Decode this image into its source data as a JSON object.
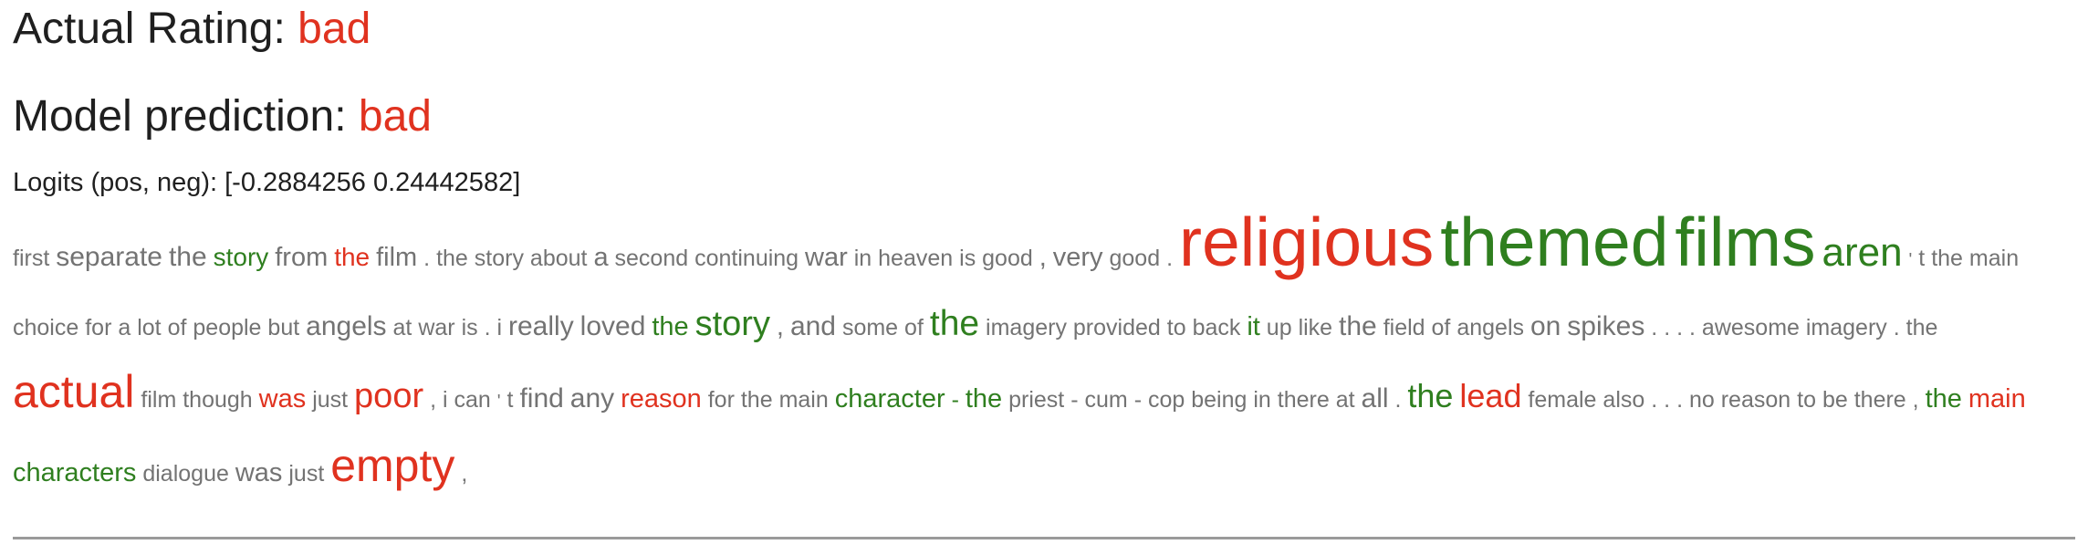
{
  "header": {
    "actual_label": "Actual Rating: ",
    "actual_value": "bad",
    "prediction_label": "Model prediction: ",
    "prediction_value": "bad",
    "logits_text": "Logits (pos, neg): [-0.2884256 0.24442582]"
  },
  "colors": {
    "negative": "#e0321f",
    "positive": "#2f7f1f",
    "neutral": "#737373"
  },
  "tokens": [
    {
      "t": "first",
      "c": "neu",
      "s": 1.0
    },
    {
      "t": "separate",
      "c": "neu",
      "s": 1.2
    },
    {
      "t": "the",
      "c": "neu",
      "s": 1.2
    },
    {
      "t": "story",
      "c": "pos",
      "s": 1.1
    },
    {
      "t": "from",
      "c": "neu",
      "s": 1.15
    },
    {
      "t": "the",
      "c": "neg",
      "s": 1.1
    },
    {
      "t": "film",
      "c": "neu",
      "s": 1.15
    },
    {
      "t": ".",
      "c": "neu",
      "s": 1.0
    },
    {
      "t": "the",
      "c": "neu",
      "s": 1.0
    },
    {
      "t": "story",
      "c": "neu",
      "s": 1.0
    },
    {
      "t": "about",
      "c": "neu",
      "s": 1.0
    },
    {
      "t": "a",
      "c": "neu",
      "s": 1.15
    },
    {
      "t": "second",
      "c": "neu",
      "s": 1.0
    },
    {
      "t": "continuing",
      "c": "neu",
      "s": 1.0
    },
    {
      "t": "war",
      "c": "neu",
      "s": 1.15
    },
    {
      "t": "in",
      "c": "neu",
      "s": 1.0
    },
    {
      "t": "heaven",
      "c": "neu",
      "s": 1.0
    },
    {
      "t": "is",
      "c": "neu",
      "s": 1.0
    },
    {
      "t": "good",
      "c": "neu",
      "s": 1.0
    },
    {
      "t": ",",
      "c": "neu",
      "s": 1.15
    },
    {
      "t": "very",
      "c": "neu",
      "s": 1.15
    },
    {
      "t": "good",
      "c": "neu",
      "s": 1.0
    },
    {
      "t": ".",
      "c": "neu",
      "s": 1.0
    },
    {
      "t": "religious",
      "c": "neg",
      "s": 3.0
    },
    {
      "t": "themed",
      "c": "pos",
      "s": 3.0
    },
    {
      "t": "films",
      "c": "pos",
      "s": 3.0
    },
    {
      "t": "aren",
      "c": "pos",
      "s": 1.75
    },
    {
      "t": "'",
      "c": "neu",
      "s": 0.8
    },
    {
      "t": "t",
      "c": "neu",
      "s": 1.0
    },
    {
      "t": "the",
      "c": "neu",
      "s": 1.0
    },
    {
      "t": "main",
      "c": "neu",
      "s": 1.0
    },
    {
      "t": "choice",
      "c": "neu",
      "s": 1.0
    },
    {
      "t": "for",
      "c": "neu",
      "s": 1.0
    },
    {
      "t": "a",
      "c": "neu",
      "s": 1.0
    },
    {
      "t": "lot",
      "c": "neu",
      "s": 1.0
    },
    {
      "t": "of",
      "c": "neu",
      "s": 1.0
    },
    {
      "t": "people",
      "c": "neu",
      "s": 1.0
    },
    {
      "t": "but",
      "c": "neu",
      "s": 1.0
    },
    {
      "t": "angels",
      "c": "neu",
      "s": 1.2
    },
    {
      "t": "at",
      "c": "neu",
      "s": 1.0
    },
    {
      "t": "war",
      "c": "neu",
      "s": 1.0
    },
    {
      "t": "is",
      "c": "neu",
      "s": 1.0
    },
    {
      "t": ".",
      "c": "neu",
      "s": 1.0
    },
    {
      "t": "i",
      "c": "neu",
      "s": 1.0
    },
    {
      "t": "really",
      "c": "neu",
      "s": 1.2
    },
    {
      "t": "loved",
      "c": "neu",
      "s": 1.2
    },
    {
      "t": "the",
      "c": "pos",
      "s": 1.15
    },
    {
      "t": "story",
      "c": "pos",
      "s": 1.5
    },
    {
      "t": ",",
      "c": "neu",
      "s": 1.15
    },
    {
      "t": "and",
      "c": "neu",
      "s": 1.2
    },
    {
      "t": "some",
      "c": "neu",
      "s": 1.0
    },
    {
      "t": "of",
      "c": "neu",
      "s": 1.0
    },
    {
      "t": "the",
      "c": "pos",
      "s": 1.55
    },
    {
      "t": "imagery",
      "c": "neu",
      "s": 1.0
    },
    {
      "t": "provided",
      "c": "neu",
      "s": 1.0
    },
    {
      "t": "to",
      "c": "neu",
      "s": 1.0
    },
    {
      "t": "back",
      "c": "neu",
      "s": 1.0
    },
    {
      "t": "it",
      "c": "pos",
      "s": 1.15
    },
    {
      "t": "up",
      "c": "neu",
      "s": 1.0
    },
    {
      "t": "like",
      "c": "neu",
      "s": 1.0
    },
    {
      "t": "the",
      "c": "neu",
      "s": 1.2
    },
    {
      "t": "field",
      "c": "neu",
      "s": 1.0
    },
    {
      "t": "of",
      "c": "neu",
      "s": 1.0
    },
    {
      "t": "angels",
      "c": "neu",
      "s": 1.0
    },
    {
      "t": "on",
      "c": "neu",
      "s": 1.2
    },
    {
      "t": "spikes",
      "c": "neu",
      "s": 1.2
    },
    {
      "t": ".",
      "c": "neu",
      "s": 1.0
    },
    {
      "t": ".",
      "c": "neu",
      "s": 1.0
    },
    {
      "t": ".",
      "c": "neu",
      "s": 1.0
    },
    {
      "t": ".",
      "c": "neu",
      "s": 1.0
    },
    {
      "t": "awesome",
      "c": "neu",
      "s": 1.0
    },
    {
      "t": "imagery",
      "c": "neu",
      "s": 1.0
    },
    {
      "t": ".",
      "c": "neu",
      "s": 1.0
    },
    {
      "t": "the",
      "c": "neu",
      "s": 1.0
    },
    {
      "t": "actual",
      "c": "neg",
      "s": 2.0
    },
    {
      "t": "film",
      "c": "neu",
      "s": 1.0
    },
    {
      "t": "though",
      "c": "neu",
      "s": 1.0
    },
    {
      "t": "was",
      "c": "neg",
      "s": 1.15
    },
    {
      "t": "just",
      "c": "neu",
      "s": 1.0
    },
    {
      "t": "poor",
      "c": "neg",
      "s": 1.5
    },
    {
      "t": ",",
      "c": "neu",
      "s": 1.0
    },
    {
      "t": "i",
      "c": "neu",
      "s": 1.0
    },
    {
      "t": "can",
      "c": "neu",
      "s": 1.0
    },
    {
      "t": "'",
      "c": "neu",
      "s": 0.8
    },
    {
      "t": "t",
      "c": "neu",
      "s": 1.0
    },
    {
      "t": "find",
      "c": "neu",
      "s": 1.2
    },
    {
      "t": "any",
      "c": "neu",
      "s": 1.2
    },
    {
      "t": "reason",
      "c": "neg",
      "s": 1.15
    },
    {
      "t": "for",
      "c": "neu",
      "s": 1.0
    },
    {
      "t": "the",
      "c": "neu",
      "s": 1.0
    },
    {
      "t": "main",
      "c": "neu",
      "s": 1.0
    },
    {
      "t": "character",
      "c": "pos",
      "s": 1.15
    },
    {
      "t": "-",
      "c": "pos",
      "s": 1.0
    },
    {
      "t": "the",
      "c": "pos",
      "s": 1.15
    },
    {
      "t": "priest",
      "c": "neu",
      "s": 1.0
    },
    {
      "t": "-",
      "c": "neu",
      "s": 1.0
    },
    {
      "t": "cum",
      "c": "neu",
      "s": 1.0
    },
    {
      "t": "-",
      "c": "neu",
      "s": 1.0
    },
    {
      "t": "cop",
      "c": "neu",
      "s": 1.0
    },
    {
      "t": "being",
      "c": "neu",
      "s": 1.0
    },
    {
      "t": "in",
      "c": "neu",
      "s": 1.0
    },
    {
      "t": "there",
      "c": "neu",
      "s": 1.0
    },
    {
      "t": "at",
      "c": "neu",
      "s": 1.0
    },
    {
      "t": "all",
      "c": "neu",
      "s": 1.2
    },
    {
      "t": ".",
      "c": "neu",
      "s": 1.0
    },
    {
      "t": "the",
      "c": "pos",
      "s": 1.45
    },
    {
      "t": "lead",
      "c": "neg",
      "s": 1.45
    },
    {
      "t": "female",
      "c": "neu",
      "s": 1.0
    },
    {
      "t": "also",
      "c": "neu",
      "s": 1.0
    },
    {
      "t": ".",
      "c": "neu",
      "s": 1.0
    },
    {
      "t": ".",
      "c": "neu",
      "s": 1.0
    },
    {
      "t": ".",
      "c": "neu",
      "s": 1.0
    },
    {
      "t": "no",
      "c": "neu",
      "s": 1.0
    },
    {
      "t": "reason",
      "c": "neu",
      "s": 1.0
    },
    {
      "t": "to",
      "c": "neu",
      "s": 1.0
    },
    {
      "t": "be",
      "c": "neu",
      "s": 1.0
    },
    {
      "t": "there",
      "c": "neu",
      "s": 1.0
    },
    {
      "t": ",",
      "c": "neu",
      "s": 1.0
    },
    {
      "t": "the",
      "c": "pos",
      "s": 1.15
    },
    {
      "t": "main",
      "c": "neg",
      "s": 1.15
    },
    {
      "t": "characters",
      "c": "pos",
      "s": 1.15
    },
    {
      "t": "dialogue",
      "c": "neu",
      "s": 1.0
    },
    {
      "t": "was",
      "c": "neu",
      "s": 1.15
    },
    {
      "t": "just",
      "c": "neu",
      "s": 1.0
    },
    {
      "t": "empty",
      "c": "neg",
      "s": 2.0
    },
    {
      "t": ",",
      "c": "neu",
      "s": 1.0
    }
  ]
}
